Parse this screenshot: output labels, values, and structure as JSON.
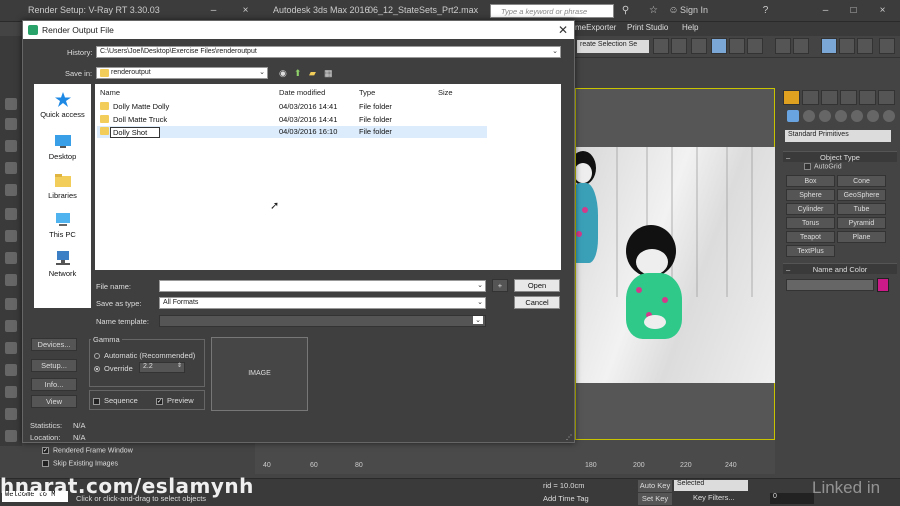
{
  "titlebar": {
    "render_setup": "Render Setup: V-Ray RT 3.30.03",
    "app_name": "Autodesk 3ds Max 2016",
    "file_name": "06_12_StateSets_Prt2.max",
    "search_placeholder": "Type a keyword or phrase",
    "sign_in": "Sign In"
  },
  "menubar": {
    "items": [
      "meExporter",
      "Print Studio",
      "Help"
    ]
  },
  "toolbar": {
    "selection_set": "reate Selection Se"
  },
  "dialog": {
    "title": "Render Output File",
    "history_label": "History:",
    "history_value": "C:\\Users\\Joel\\Desktop\\Exercise Files\\renderoutput",
    "savein_label": "Save in:",
    "savein_value": "renderoutput",
    "places": [
      "Quick access",
      "Desktop",
      "Libraries",
      "This PC",
      "Network"
    ],
    "columns": [
      "Name",
      "Date modified",
      "Type",
      "Size"
    ],
    "files": [
      {
        "name": "Dolly Matte Dolly",
        "date": "04/03/2016 14:41",
        "type": "File folder",
        "size": ""
      },
      {
        "name": "Doll Matte Truck",
        "date": "04/03/2016 14:41",
        "type": "File folder",
        "size": ""
      },
      {
        "name": "Dolly Shot",
        "date": "04/03/2016 16:10",
        "type": "File folder",
        "size": ""
      }
    ],
    "filename_label": "File name:",
    "filename_value": "",
    "saveastype_label": "Save as type:",
    "saveastype_value": "All Formats",
    "nametemplate_label": "Name template:",
    "open_label": "Open",
    "cancel_label": "Cancel",
    "plus_label": "+",
    "devices_label": "Devices...",
    "setup_label": "Setup...",
    "info_label": "Info...",
    "view_label": "View",
    "gamma_label": "Gamma",
    "automatic_label": "Automatic (Recommended)",
    "override_label": "Override",
    "override_value": "2.2",
    "image_label": "IMAGE",
    "sequence_label": "Sequence",
    "preview_label": "Preview",
    "statistics_label": "Statistics:",
    "statistics_value": "N/A",
    "location_label": "Location:",
    "location_value": "N/A"
  },
  "command_panel": {
    "dropdown": "Standard Primitives",
    "object_type_header": "Object Type",
    "autogrid": "AutoGrid",
    "buttons": [
      "Box",
      "Cone",
      "Sphere",
      "GeoSphere",
      "Cylinder",
      "Tube",
      "Torus",
      "Pyramid",
      "Teapot",
      "Plane",
      "TextPlus"
    ],
    "name_color_header": "Name and Color",
    "swatch_color": "#cc1a88"
  },
  "render_setup": {
    "rendered_frame_window": "Rendered Frame Window",
    "skip_existing": "Skip Existing Images"
  },
  "timeline": {
    "ticks": [
      "40",
      "60",
      "80",
      "180",
      "200",
      "220",
      "240"
    ]
  },
  "statusbar": {
    "maxscript": "Welcome to M",
    "status_text": "Click or click-and-drag to select objects",
    "grid": "rid = 10.0cm",
    "add_time_tag": "Add Time Tag",
    "auto_key": "Auto Key",
    "set_key": "Set Key",
    "selected": "Selected",
    "key_filters": "Key Filters...",
    "frame": "0"
  },
  "overlay": {
    "watermark": "hnarat.com/eslamynh",
    "brand": "Linked in"
  }
}
